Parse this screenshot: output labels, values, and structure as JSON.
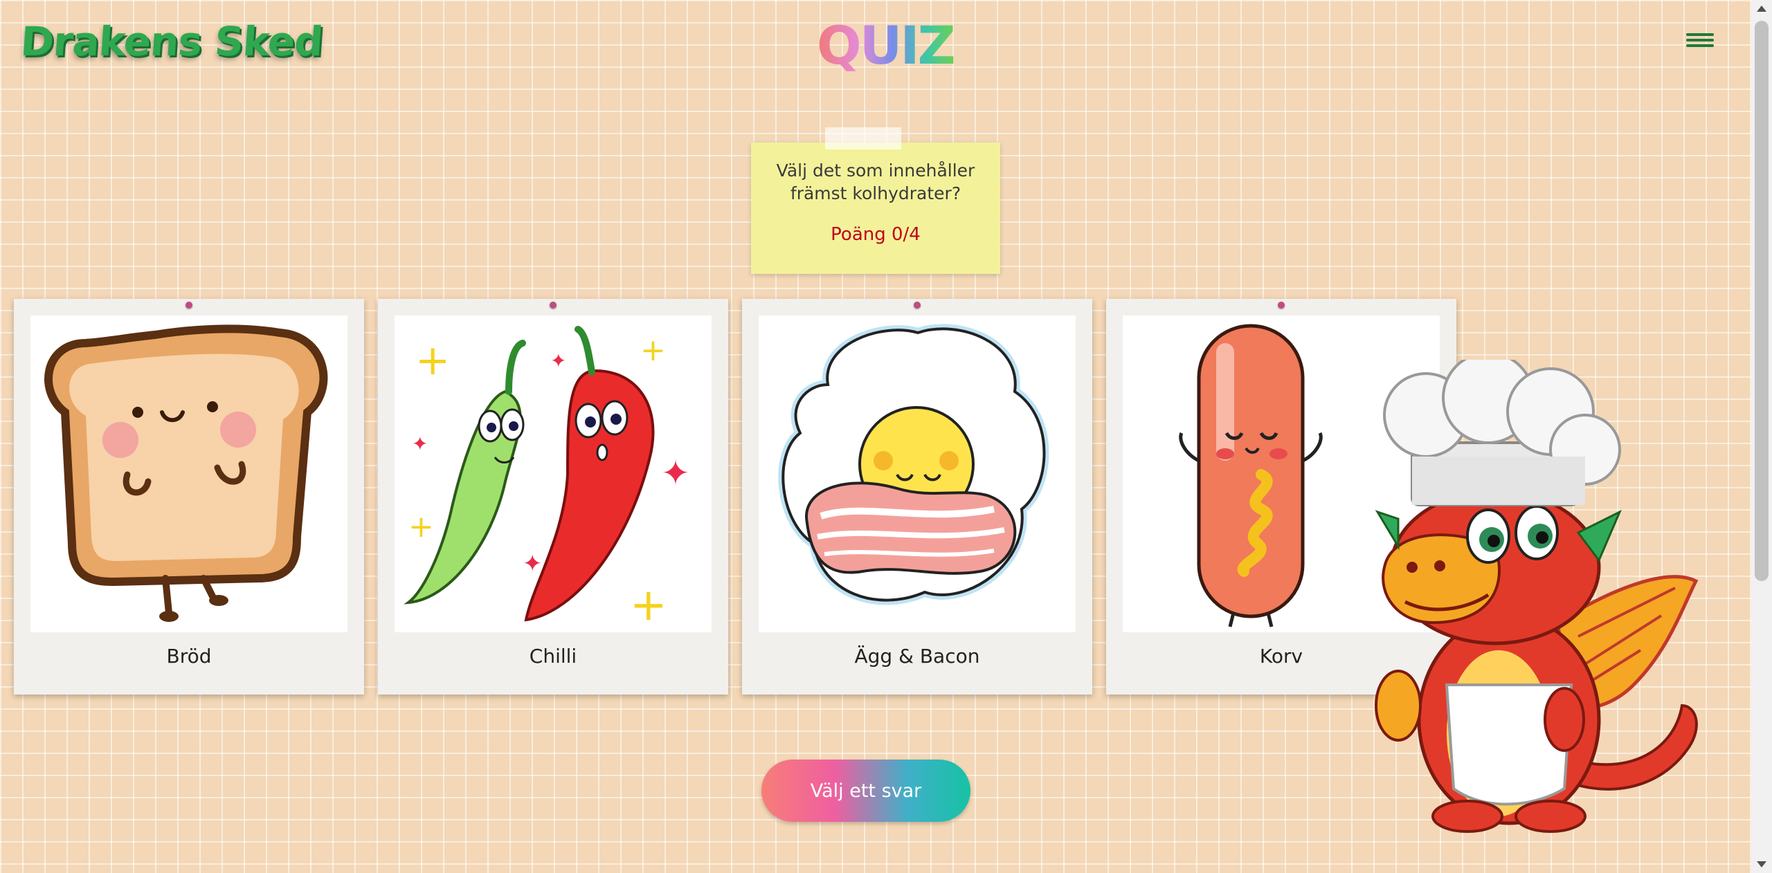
{
  "header": {
    "logo_text": "Drakens Sked",
    "title": "QUIZ",
    "menu_icon": "hamburger-icon"
  },
  "question_card": {
    "question": "Välj det som innehåller främst kolhydrater?",
    "score": "Poäng 0/4"
  },
  "options": [
    {
      "label": "Bröd",
      "image": "bread-illustration"
    },
    {
      "label": "Chilli",
      "image": "chili-peppers-illustration"
    },
    {
      "label": "Ägg & Bacon",
      "image": "egg-and-bacon-illustration"
    },
    {
      "label": "Korv",
      "image": "sausage-illustration"
    }
  ],
  "answer_button": {
    "label": "Välj ett svar"
  },
  "mascot": {
    "image": "chef-dragon-mascot"
  },
  "colors": {
    "logo_green": "#2fa84f",
    "score_red": "#c0001c",
    "sticky_yellow": "#f3f29a",
    "background_brick": "#f3d7b6"
  }
}
